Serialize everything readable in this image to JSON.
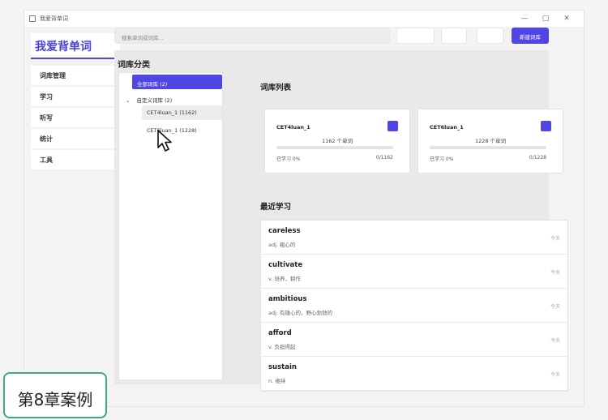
{
  "window": {
    "title": "我爱背单词",
    "controls": [
      "—",
      "▢",
      "✕"
    ]
  },
  "sidebar": {
    "brand": "我爱背单词",
    "items": [
      {
        "label": "词库管理"
      },
      {
        "label": "学习"
      },
      {
        "label": "听写"
      },
      {
        "label": "统计"
      },
      {
        "label": "工具"
      }
    ]
  },
  "toolbar": {
    "search_placeholder": "搜索单词或词库...",
    "new_library_label": "新建词库"
  },
  "library": {
    "title": "词库分类",
    "all_label": "全部词库 (2)",
    "group_label": "自定义词库 (2)",
    "group_chevron": "⌄",
    "leaves": [
      {
        "label": "CET4luan_1 (1162)"
      },
      {
        "label": "CET6luan_1 (1228)"
      }
    ]
  },
  "list": {
    "title": "词库列表",
    "cards": [
      {
        "name": "CET4luan_1",
        "count": "1162 个单词",
        "progress_label": "已学习 0%",
        "ratio": "0/1162",
        "progress": 0,
        "color": "#4f46e5"
      },
      {
        "name": "CET6luan_1",
        "count": "1228 个单词",
        "progress_label": "已学习 0%",
        "ratio": "0/1228",
        "progress": 0,
        "color": "#4f46e5"
      }
    ]
  },
  "recent": {
    "title": "最近学习",
    "rows": [
      {
        "word": "careless",
        "definition": "adj. 粗心的",
        "time": "今天"
      },
      {
        "word": "cultivate",
        "definition": "v. 培养，耕作",
        "time": "今天"
      },
      {
        "word": "ambitious",
        "definition": "adj. 有雄心的，野心勃勃的",
        "time": "今天"
      },
      {
        "word": "afford",
        "definition": "v. 负担得起",
        "time": "今天"
      },
      {
        "word": "sustain",
        "definition": "n. 维持",
        "time": "今天"
      }
    ]
  },
  "overlay": {
    "chapter_label": "第8章案例"
  },
  "colors": {
    "accent": "#4f46e5",
    "badge_border": "#3aa88a"
  }
}
